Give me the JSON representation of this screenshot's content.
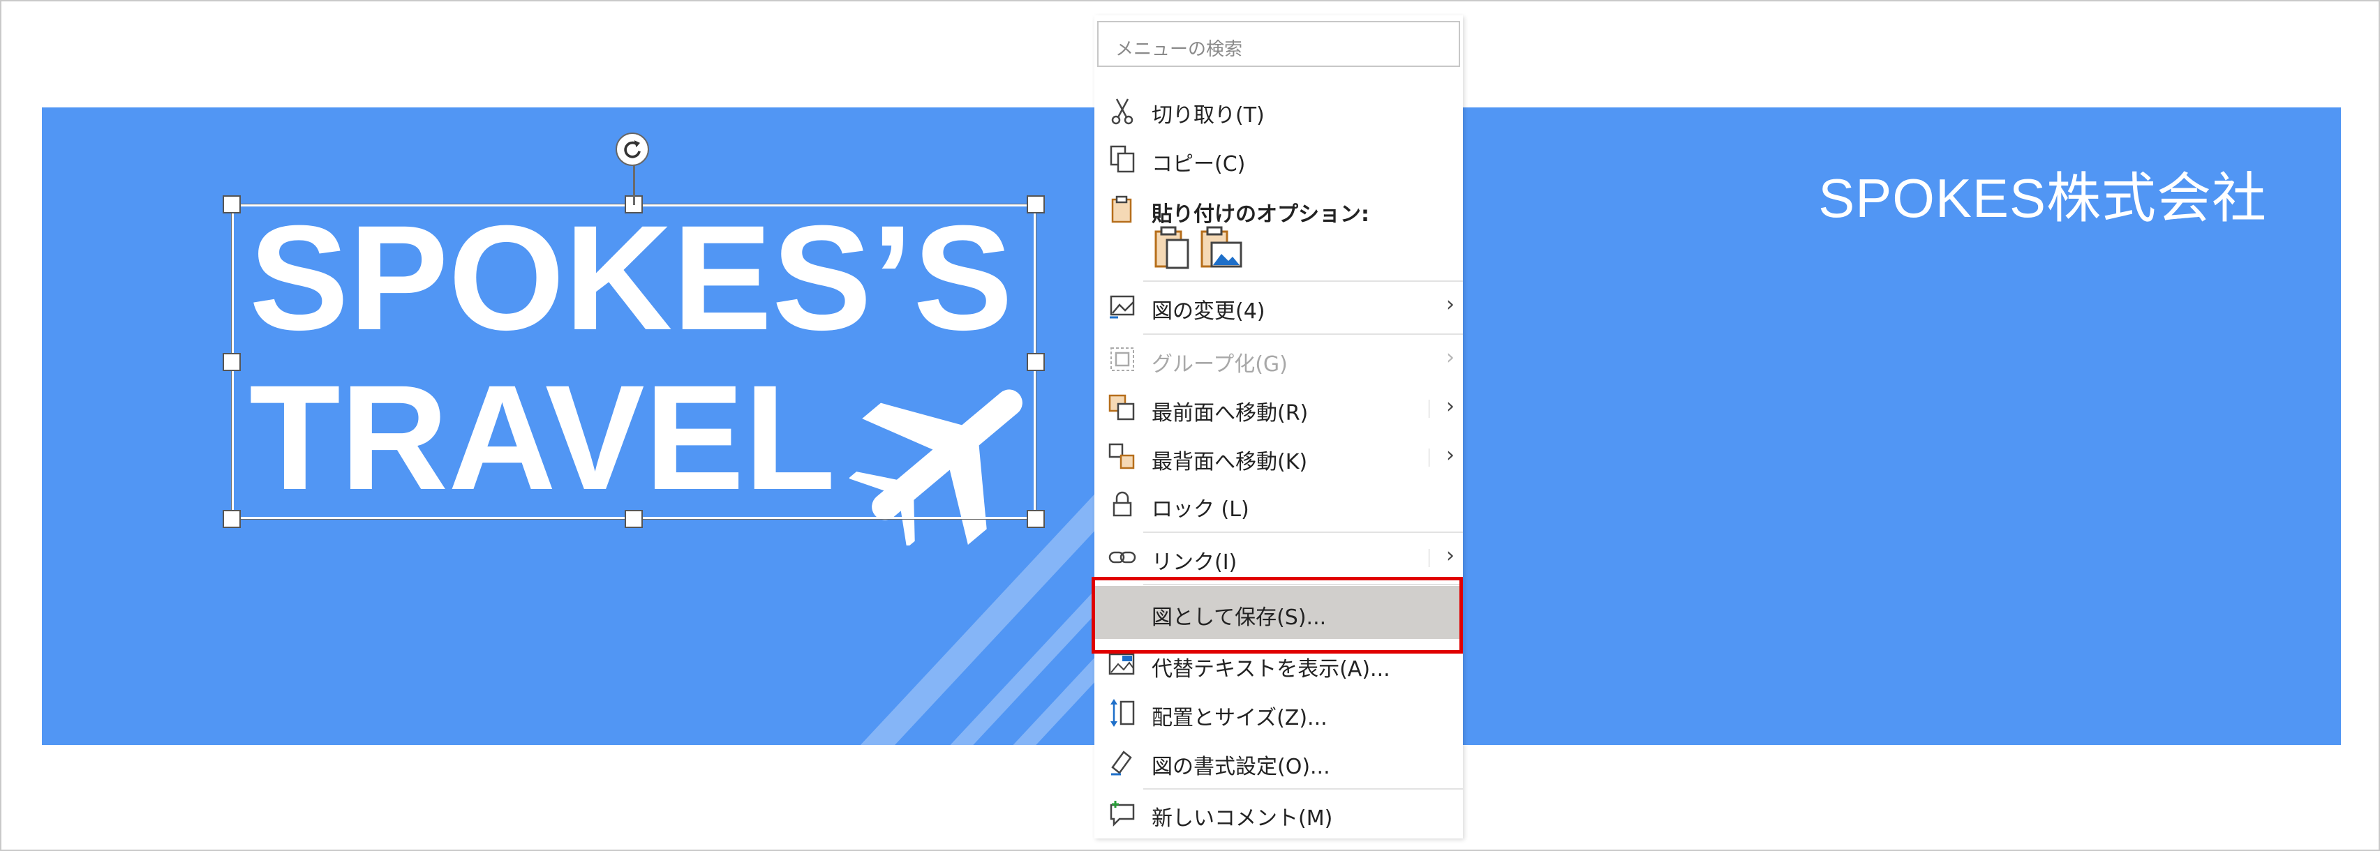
{
  "slide": {
    "company_name": "SPOKES株式会社",
    "title_line1": "SPOKES’S",
    "title_line2": "TRAVEL",
    "colors": {
      "banner": "#5196f4",
      "text": "#ffffff"
    }
  },
  "context_menu": {
    "search_placeholder": "メニューの検索",
    "cut": "切り取り(T)",
    "copy": "コピー(C)",
    "paste_options": "貼り付けのオプション:",
    "change_picture": "図の変更(4)",
    "group": "グループ化(G)",
    "bring_to_front": "最前面へ移動(R)",
    "send_to_back": "最背面へ移動(K)",
    "lock": "ロック (L)",
    "link": "リンク(I)",
    "save_as_picture": "図として保存(S)...",
    "alt_text": "代替テキストを表示(A)...",
    "size_position": "配置とサイズ(Z)...",
    "format_picture": "図の書式設定(O)...",
    "new_comment": "新しいコメント(M)",
    "submenu_arrow": "›"
  },
  "highlight": {
    "target": "save_as_picture",
    "color": "#e00000"
  }
}
